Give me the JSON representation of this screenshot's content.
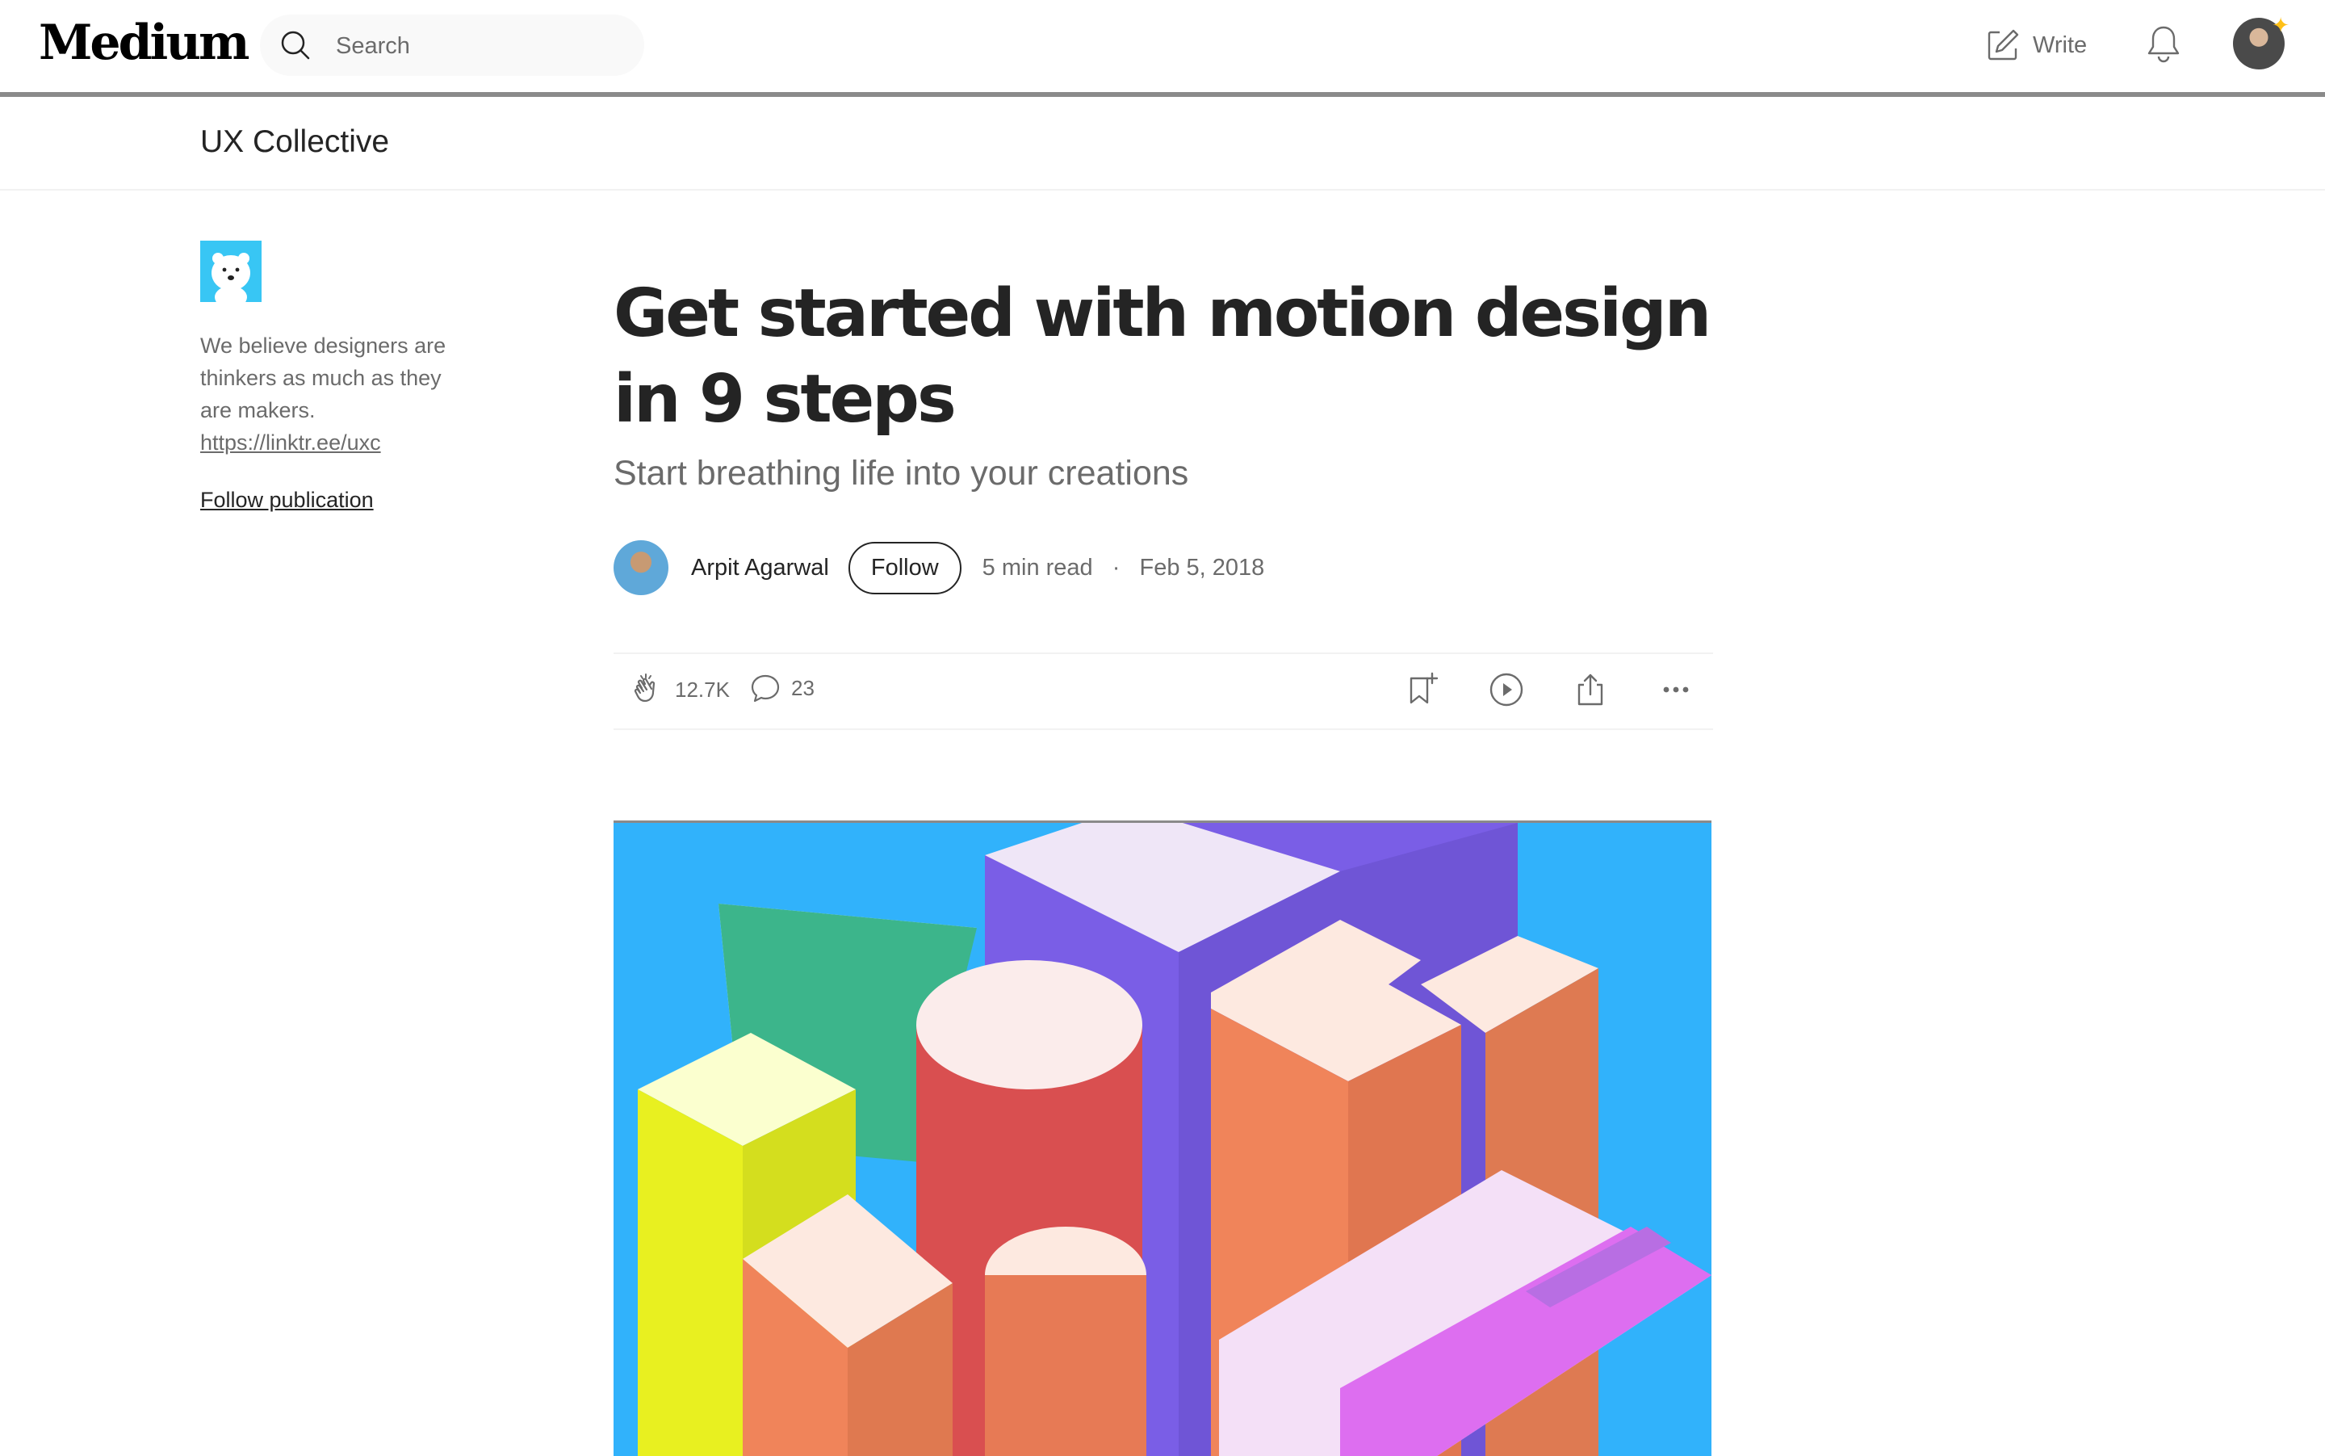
{
  "header": {
    "logo": "Medium",
    "search_placeholder": "Search",
    "write_label": "Write"
  },
  "publication": {
    "name": "UX Collective",
    "description": "We believe designers are thinkers as much as they are makers.",
    "link": "https://linktr.ee/uxc",
    "follow_label": "Follow publication"
  },
  "article": {
    "title": "Get started with motion design in 9 steps",
    "subtitle": "Start breathing life into your creations",
    "author": "Arpit Agarwal",
    "follow_label": "Follow",
    "read_time": "5 min read",
    "separator": "·",
    "date": "Feb 5, 2018"
  },
  "actions": {
    "claps": "12.7K",
    "responses": "23"
  },
  "colors": {
    "accent": "#ffc017",
    "hero_background": "#31b2fb"
  },
  "icons": [
    "search-icon",
    "write-icon",
    "bell-icon",
    "clap-icon",
    "comment-icon",
    "bookmark-icon",
    "play-icon",
    "share-icon",
    "more-icon"
  ]
}
